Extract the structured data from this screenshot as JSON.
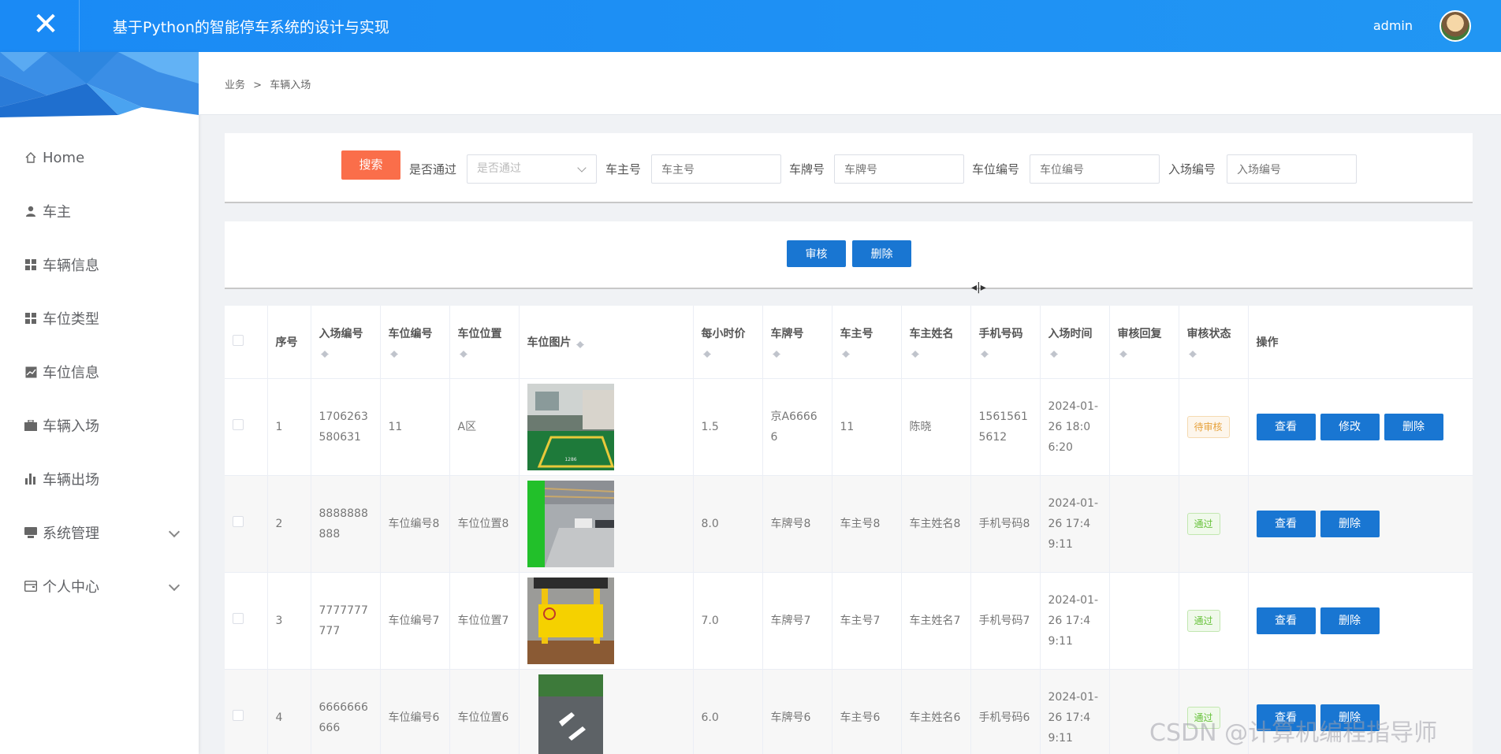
{
  "app": {
    "title": "基于Python的智能停车系统的设计与实现",
    "user": "admin",
    "close_glyph": "✕"
  },
  "sidebar": {
    "items": [
      {
        "label": "Home",
        "icon": "home-icon"
      },
      {
        "label": "车主",
        "icon": "user-icon"
      },
      {
        "label": "车辆信息",
        "icon": "grid-icon"
      },
      {
        "label": "车位类型",
        "icon": "grid-icon"
      },
      {
        "label": "车位信息",
        "icon": "chart-icon"
      },
      {
        "label": "车辆入场",
        "icon": "briefcase-icon"
      },
      {
        "label": "车辆出场",
        "icon": "bar-chart-icon"
      },
      {
        "label": "系统管理",
        "icon": "monitor-icon"
      },
      {
        "label": "个人中心",
        "icon": "wallet-icon"
      }
    ]
  },
  "breadcrumb": {
    "root": "业务",
    "sep": ">",
    "current": "车辆入场"
  },
  "search": {
    "button": "搜索",
    "fields": [
      {
        "label": "是否通过",
        "placeholder": "是否通过"
      },
      {
        "label": "车主号",
        "placeholder": "车主号"
      },
      {
        "label": "车牌号",
        "placeholder": "车牌号"
      },
      {
        "label": "车位编号",
        "placeholder": "车位编号"
      },
      {
        "label": "入场编号",
        "placeholder": "入场编号"
      }
    ]
  },
  "actions": {
    "audit": "审核",
    "delete": "删除"
  },
  "table": {
    "headers": [
      "序号",
      "入场编号",
      "车位编号",
      "车位位置",
      "车位图片",
      "每小时价",
      "车牌号",
      "车主号",
      "车主姓名",
      "手机号码",
      "入场时间",
      "审核回复",
      "审核状态",
      "操作"
    ],
    "rows": [
      {
        "idx": "1",
        "entry_no": "1706263580631",
        "spot_no": "11",
        "spot_loc": "A区",
        "price": "1.5",
        "plate": "京A66666",
        "owner_no": "11",
        "owner_name": "陈晓",
        "phone": "15615615612",
        "time": "2024-01-26 18:06:20",
        "reply": "",
        "status": "待审核",
        "ops": [
          "查看",
          "修改",
          "删除"
        ]
      },
      {
        "idx": "2",
        "entry_no": "8888888888",
        "spot_no": "车位编号8",
        "spot_loc": "车位位置8",
        "price": "8.0",
        "plate": "车牌号8",
        "owner_no": "车主号8",
        "owner_name": "车主姓名8",
        "phone": "手机号码8",
        "time": "2024-01-26 17:49:11",
        "reply": "",
        "status": "通过",
        "ops": [
          "查看",
          "删除"
        ]
      },
      {
        "idx": "3",
        "entry_no": "7777777777",
        "spot_no": "车位编号7",
        "spot_loc": "车位位置7",
        "price": "7.0",
        "plate": "车牌号7",
        "owner_no": "车主号7",
        "owner_name": "车主姓名7",
        "phone": "手机号码7",
        "time": "2024-01-26 17:49:11",
        "reply": "",
        "status": "通过",
        "ops": [
          "查看",
          "删除"
        ]
      },
      {
        "idx": "4",
        "entry_no": "6666666666",
        "spot_no": "车位编号6",
        "spot_loc": "车位位置6",
        "price": "6.0",
        "plate": "车牌号6",
        "owner_no": "车主号6",
        "owner_name": "车主姓名6",
        "phone": "手机号码6",
        "time": "2024-01-26 17:49:11",
        "reply": "",
        "status": "通过",
        "ops": [
          "查看",
          "删除"
        ]
      }
    ]
  },
  "watermark": "CSDN @计算机编程指导师"
}
